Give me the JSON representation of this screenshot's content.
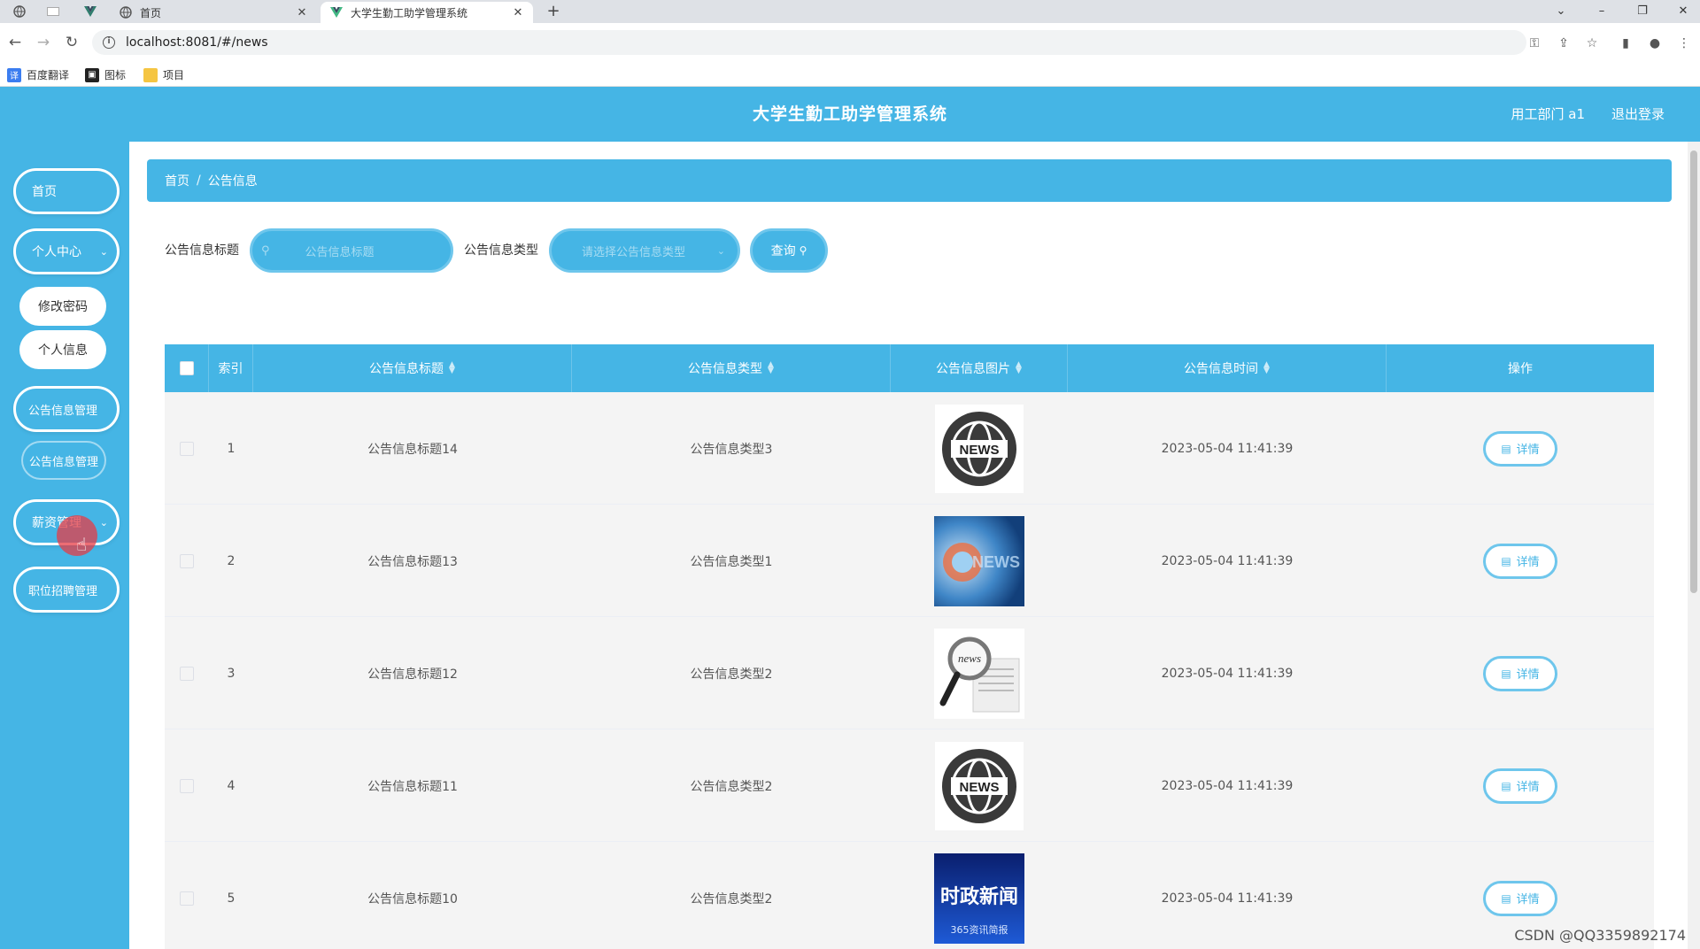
{
  "browser": {
    "tabs": [
      {
        "title": "首页"
      },
      {
        "title": "大学生勤工助学管理系统"
      }
    ],
    "url": "localhost:8081/#/news",
    "bookmarks": [
      "百度翻译",
      "图标",
      "项目"
    ]
  },
  "header": {
    "title": "大学生勤工助学管理系统",
    "user": "用工部门 a1",
    "logout": "退出登录"
  },
  "sidebar": {
    "items": [
      {
        "label": "首页"
      },
      {
        "label": "个人中心"
      },
      {
        "label": "修改密码"
      },
      {
        "label": "个人信息"
      },
      {
        "label": "公告信息管理"
      },
      {
        "label": "公告信息管理"
      },
      {
        "label": "薪资管理"
      },
      {
        "label": "职位招聘管理"
      }
    ]
  },
  "breadcrumb": {
    "home": "首页",
    "sep": "/",
    "current": "公告信息"
  },
  "search": {
    "title_label": "公告信息标题",
    "title_placeholder": "公告信息标题",
    "type_label": "公告信息类型",
    "type_placeholder": "请选择公告信息类型",
    "query_button": "查询"
  },
  "table": {
    "columns": [
      "索引",
      "公告信息标题",
      "公告信息类型",
      "公告信息图片",
      "公告信息时间",
      "操作"
    ],
    "detail_label": "详情",
    "rows": [
      {
        "index": "1",
        "title": "公告信息标题14",
        "type": "公告信息类型3",
        "image": "news-globe-icon",
        "time": "2023-05-04 11:41:39"
      },
      {
        "index": "2",
        "title": "公告信息标题13",
        "type": "公告信息类型1",
        "image": "news-blue-graphic",
        "time": "2023-05-04 11:41:39"
      },
      {
        "index": "3",
        "title": "公告信息标题12",
        "type": "公告信息类型2",
        "image": "news-magnifier",
        "time": "2023-05-04 11:41:39"
      },
      {
        "index": "4",
        "title": "公告信息标题11",
        "type": "公告信息类型2",
        "image": "news-globe-icon",
        "time": "2023-05-04 11:41:39"
      },
      {
        "index": "5",
        "title": "公告信息标题10",
        "type": "公告信息类型2",
        "image": "shizheng-news-banner",
        "image_text": "时政新闻",
        "image_subtext": "365资讯简报",
        "time": "2023-05-04 11:41:39"
      }
    ]
  },
  "watermark": "CSDN @QQ3359892174",
  "colors": {
    "primary": "#45b5e5",
    "row_bg": "#f4f4f4"
  }
}
